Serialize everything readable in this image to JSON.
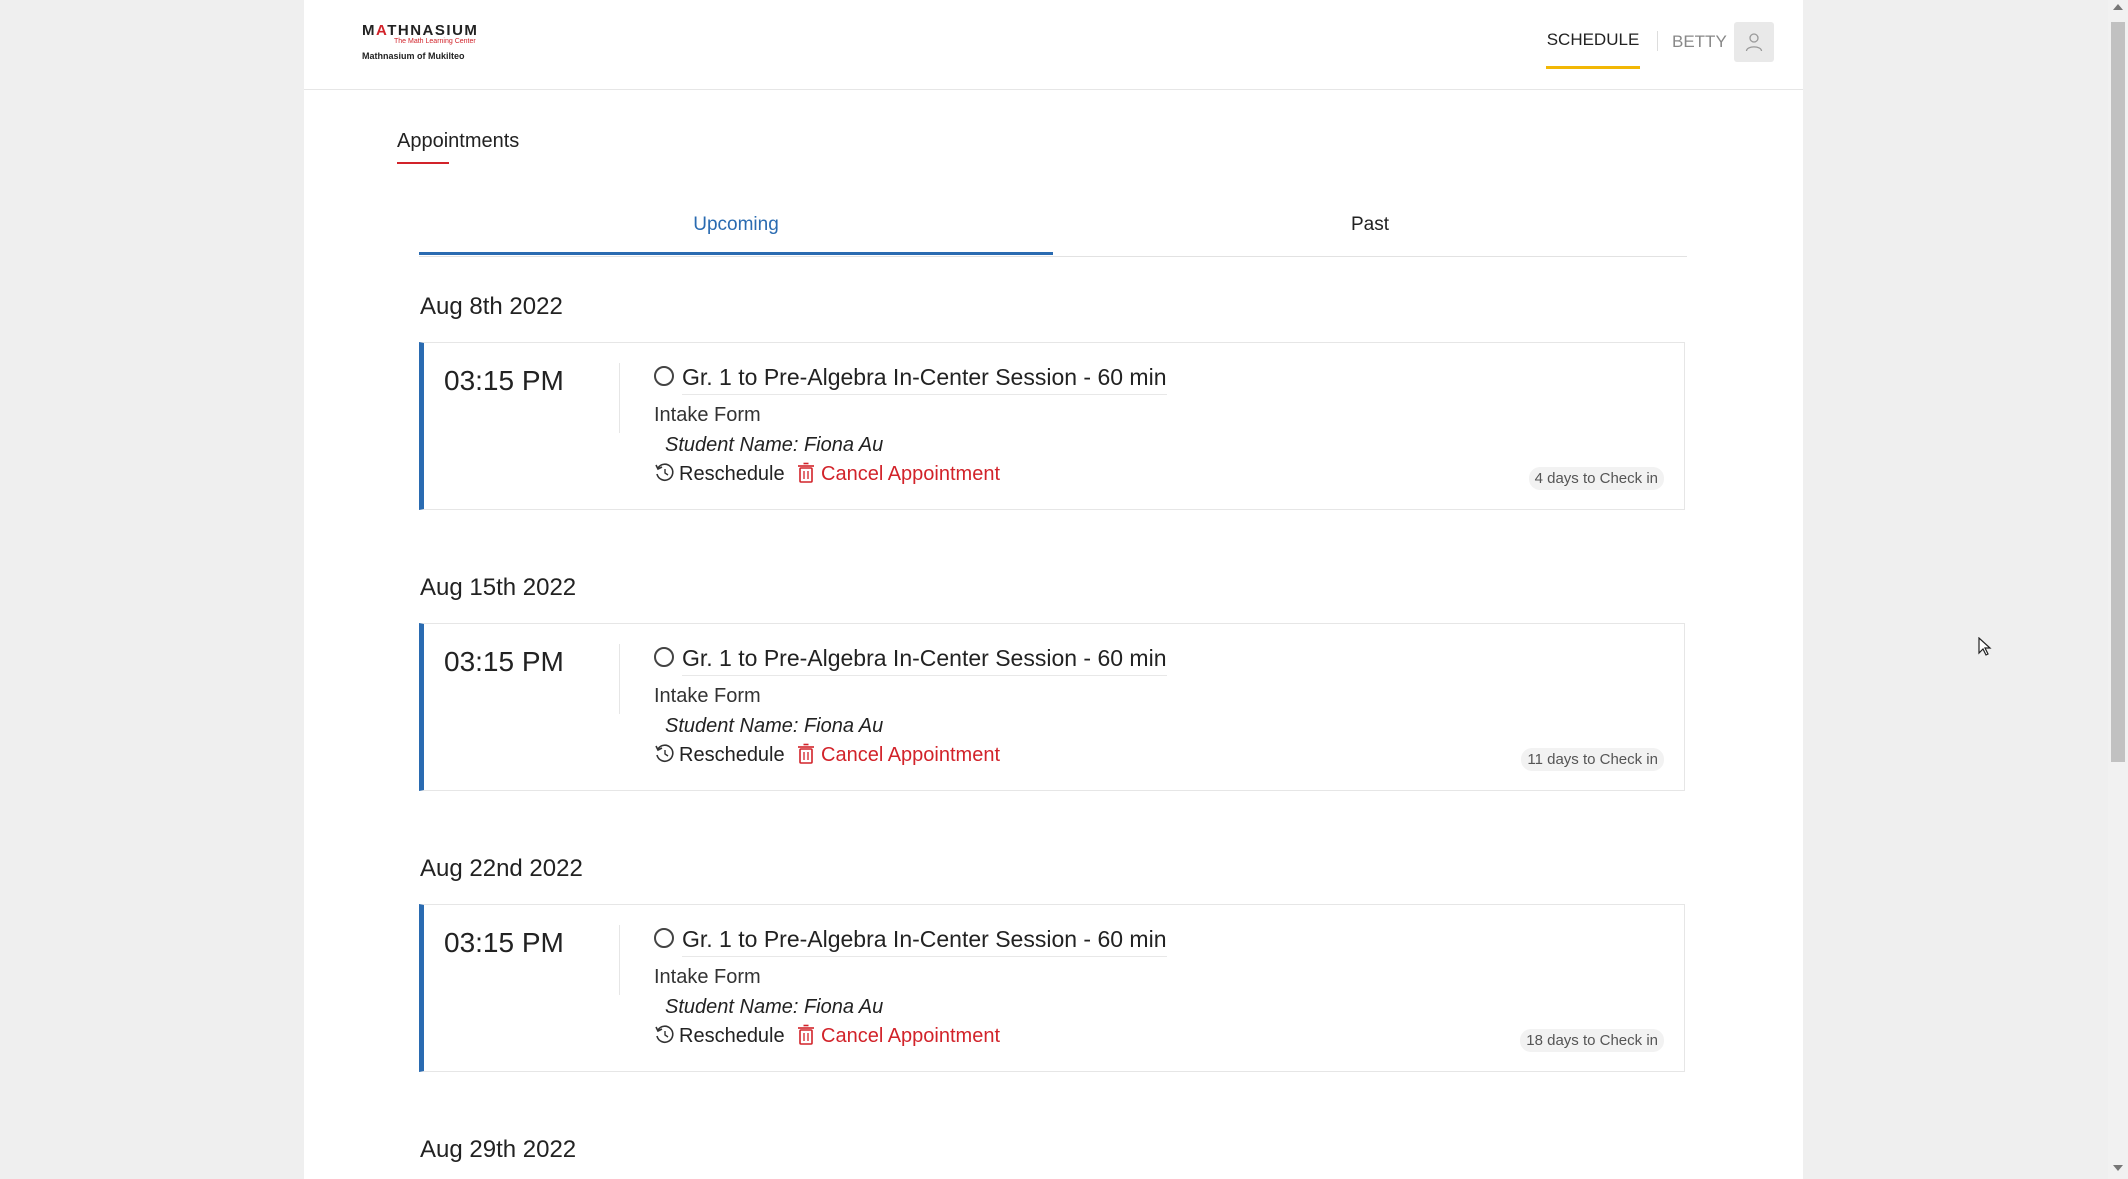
{
  "header": {
    "logo": {
      "brand_pre": "M",
      "brand_hat": "A",
      "brand_post": "THNASIUM",
      "tagline": "The Math Learning Center",
      "location": "Mathnasium of Mukilteo"
    },
    "nav": {
      "schedule": "SCHEDULE",
      "user": "BETTY"
    },
    "icons": {
      "avatar": "user-icon"
    }
  },
  "section": {
    "title": "Appointments"
  },
  "tabs": [
    {
      "label": "Upcoming",
      "active": true
    },
    {
      "label": "Past",
      "active": false
    }
  ],
  "appointments": [
    {
      "date": "Aug 8th 2022",
      "time": "03:15 PM",
      "service": "Gr. 1 to Pre-Algebra In-Center Session - 60 min",
      "form": "Intake Form",
      "student": "Student Name: Fiona Au",
      "reschedule": "Reschedule",
      "cancel": "Cancel Appointment",
      "checkin": "4 days to Check in"
    },
    {
      "date": "Aug 15th 2022",
      "time": "03:15 PM",
      "service": "Gr. 1 to Pre-Algebra In-Center Session - 60 min",
      "form": "Intake Form",
      "student": "Student Name: Fiona Au",
      "reschedule": "Reschedule",
      "cancel": "Cancel Appointment",
      "checkin": "11 days to Check in"
    },
    {
      "date": "Aug 22nd 2022",
      "time": "03:15 PM",
      "service": "Gr. 1 to Pre-Algebra In-Center Session - 60 min",
      "form": "Intake Form",
      "student": "Student Name: Fiona Au",
      "reschedule": "Reschedule",
      "cancel": "Cancel Appointment",
      "checkin": "18 days to Check in"
    },
    {
      "date": "Aug 29th 2022"
    }
  ],
  "colors": {
    "accent_blue": "#2a6bb1",
    "brand_red": "#d2232a",
    "nav_underline": "#f2b705"
  }
}
